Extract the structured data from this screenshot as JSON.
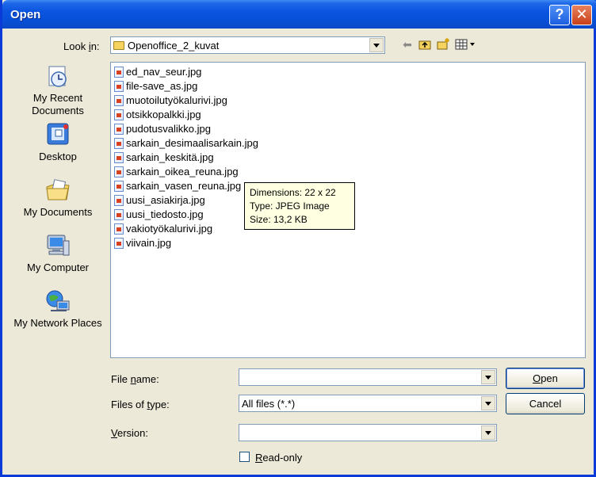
{
  "window": {
    "title": "Open"
  },
  "titlebar": {
    "help_glyph": "?",
    "close_glyph": "✕"
  },
  "lookin": {
    "label_pre": "Look ",
    "label_u": "i",
    "label_post": "n:",
    "value": "Openoffice_2_kuvat"
  },
  "toolbar": {
    "back_icon": "back-arrow-icon",
    "up_icon": "up-folder-icon",
    "new_folder_icon": "new-folder-icon",
    "views_icon": "views-menu-icon"
  },
  "places": [
    {
      "label": "My Recent Documents",
      "icon": "recent-documents-icon"
    },
    {
      "label": "Desktop",
      "icon": "desktop-icon"
    },
    {
      "label": "My Documents",
      "icon": "my-documents-icon"
    },
    {
      "label": "My Computer",
      "icon": "my-computer-icon"
    },
    {
      "label": "My Network Places",
      "icon": "network-places-icon"
    }
  ],
  "files": [
    "ed_nav_seur.jpg",
    "file-save_as.jpg",
    "muotoilutyökalurivi.jpg",
    "otsikkopalkki.jpg",
    "pudotusvalikko.jpg",
    "sarkain_desimaalisarkain.jpg",
    "sarkain_keskitä.jpg",
    "sarkain_oikea_reuna.jpg",
    "sarkain_vasen_reuna.jpg",
    "uusi_asiakirja.jpg",
    "uusi_tiedosto.jpg",
    "vakiotyökalurivi.jpg",
    "viivain.jpg"
  ],
  "tooltip": {
    "dimensions": "Dimensions: 22 x 22",
    "type": "Type: JPEG Image",
    "size": "Size: 13,2 KB"
  },
  "filename": {
    "label_pre": "File ",
    "label_u": "n",
    "label_post": "ame:",
    "value": ""
  },
  "filetype": {
    "label_pre": "Files of ",
    "label_u": "t",
    "label_post": "ype:",
    "value": "All files (*.*)"
  },
  "version": {
    "label_pre": "",
    "label_u": "V",
    "label_post": "ersion:",
    "value": ""
  },
  "buttons": {
    "open_u": "O",
    "open_rest": "pen",
    "cancel": "Cancel"
  },
  "readonly": {
    "label_u": "R",
    "label_rest": "ead-only",
    "checked": false
  }
}
